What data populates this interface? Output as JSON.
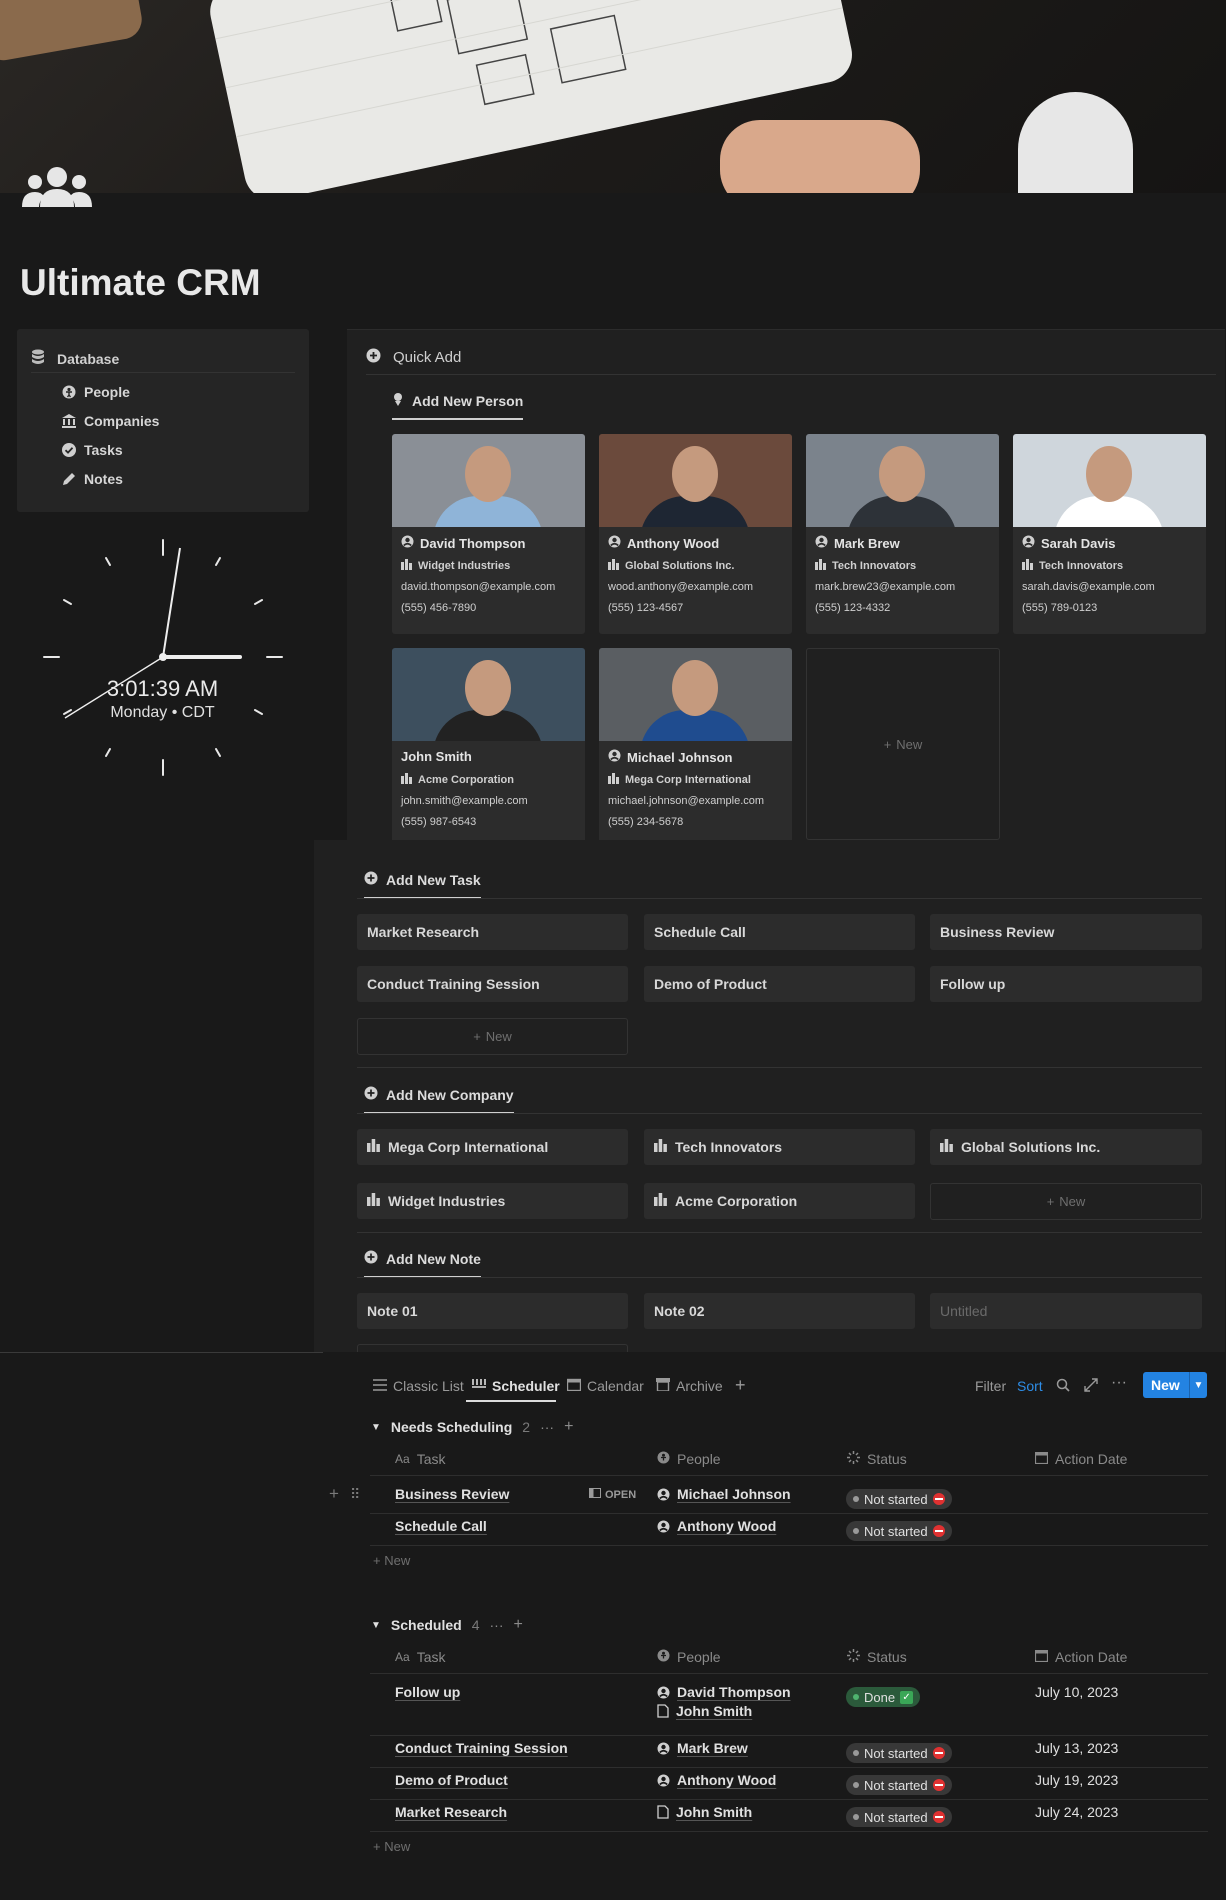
{
  "page": {
    "title": "Ultimate CRM",
    "icon": "people-group-icon"
  },
  "database_nav": {
    "heading": "Database",
    "items": [
      {
        "label": "People",
        "icon": "person-icon"
      },
      {
        "label": "Companies",
        "icon": "bank-icon"
      },
      {
        "label": "Tasks",
        "icon": "check-circle-icon"
      },
      {
        "label": "Notes",
        "icon": "pencil-icon"
      }
    ]
  },
  "clock": {
    "time": "3:01:39 AM",
    "date": "Monday • CDT"
  },
  "quick_add": {
    "heading": "Quick Add",
    "people_tab": "Add New Person",
    "people": [
      {
        "name": "David Thompson",
        "company": "Widget Industries",
        "email": "david.thompson@example.com",
        "phone": "(555) 456-7890"
      },
      {
        "name": "Anthony Wood",
        "company": "Global Solutions Inc.",
        "email": "wood.anthony@example.com",
        "phone": "(555) 123-4567"
      },
      {
        "name": "Mark Brew",
        "company": "Tech Innovators",
        "email": "mark.brew23@example.com",
        "phone": "(555) 123-4332"
      },
      {
        "name": "Sarah Davis",
        "company": "Tech Innovators",
        "email": "sarah.davis@example.com",
        "phone": "(555) 789-0123"
      },
      {
        "name": "John Smith",
        "company": "Acme Corporation",
        "email": "john.smith@example.com",
        "phone": "(555) 987-6543"
      },
      {
        "name": "Michael Johnson",
        "company": "Mega Corp International",
        "email": "michael.johnson@example.com",
        "phone": "(555) 234-5678"
      }
    ],
    "new_label": "New",
    "task_tab": "Add New Task",
    "tasks": [
      "Market Research",
      "Schedule Call",
      "Business Review",
      "Conduct Training Session",
      "Demo of Product",
      "Follow up"
    ],
    "company_tab": "Add New Company",
    "companies": [
      "Mega Corp International",
      "Tech Innovators",
      "Global Solutions Inc.",
      "Widget Industries",
      "Acme Corporation"
    ],
    "note_tab": "Add New Note",
    "notes": [
      "Note 01",
      "Note 02",
      "Untitled"
    ]
  },
  "scheduler": {
    "views": [
      "Classic List",
      "Scheduler",
      "Calendar",
      "Archive"
    ],
    "active_view": "Scheduler",
    "toolbar": {
      "filter": "Filter",
      "sort": "Sort",
      "new": "New"
    },
    "columns": {
      "task": "Task",
      "people": "People",
      "status": "Status",
      "action_date": "Action Date"
    },
    "open_label": "OPEN",
    "add_new": "New",
    "groups": [
      {
        "name": "Needs Scheduling",
        "count": "2",
        "rows": [
          {
            "task": "Business Review",
            "people": [
              "Michael Johnson"
            ],
            "status": "Not started",
            "date": ""
          },
          {
            "task": "Schedule Call",
            "people": [
              "Anthony Wood"
            ],
            "status": "Not started",
            "date": ""
          }
        ]
      },
      {
        "name": "Scheduled",
        "count": "4",
        "rows": [
          {
            "task": "Follow up",
            "people": [
              "David Thompson",
              "John Smith"
            ],
            "status": "Done",
            "date": "July 10, 2023"
          },
          {
            "task": "Conduct Training Session",
            "people": [
              "Mark Brew"
            ],
            "status": "Not started",
            "date": "July 13, 2023"
          },
          {
            "task": "Demo of Product",
            "people": [
              "Anthony Wood"
            ],
            "status": "Not started",
            "date": "July 19, 2023"
          },
          {
            "task": "Market Research",
            "people": [
              "John Smith"
            ],
            "status": "Not started",
            "date": "July 24, 2023"
          }
        ]
      }
    ]
  },
  "colors": {
    "background": "#191919",
    "panel": "#202020",
    "card": "#2c2c2c",
    "accent": "#2383e2",
    "done": "#2b5a3b",
    "not_started": "#383838"
  }
}
